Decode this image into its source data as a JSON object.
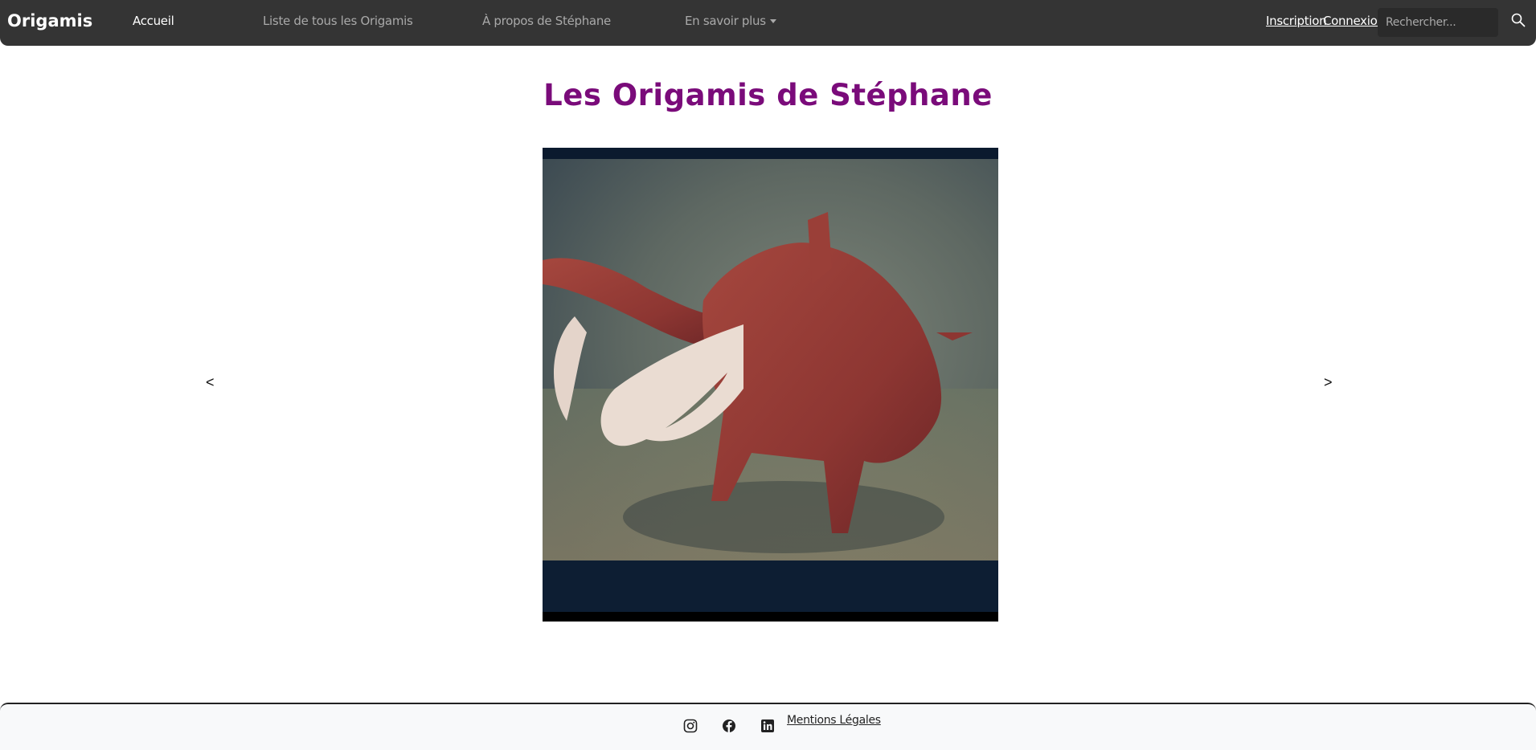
{
  "navbar": {
    "brand": "Origamis",
    "links": [
      {
        "label": "Accueil",
        "active": true
      },
      {
        "label": "Liste de tous les Origamis",
        "active": false
      },
      {
        "label": "À propos de Stéphane",
        "active": false
      },
      {
        "label": "En savoir plus",
        "active": false
      }
    ],
    "signup": "Inscription",
    "login": "Connexion",
    "search_placeholder": "Rechercher..."
  },
  "main": {
    "title": "Les Origamis de Stéphane",
    "carousel": {
      "prev": "<",
      "next": ">"
    }
  },
  "footer": {
    "legal": "Mentions Légales",
    "icons": [
      "instagram-icon",
      "facebook-icon",
      "linkedin-icon"
    ]
  },
  "colors": {
    "navbar_bg": "#343434",
    "title": "#7a0b7a",
    "footer_bg": "#f8f9fa"
  }
}
